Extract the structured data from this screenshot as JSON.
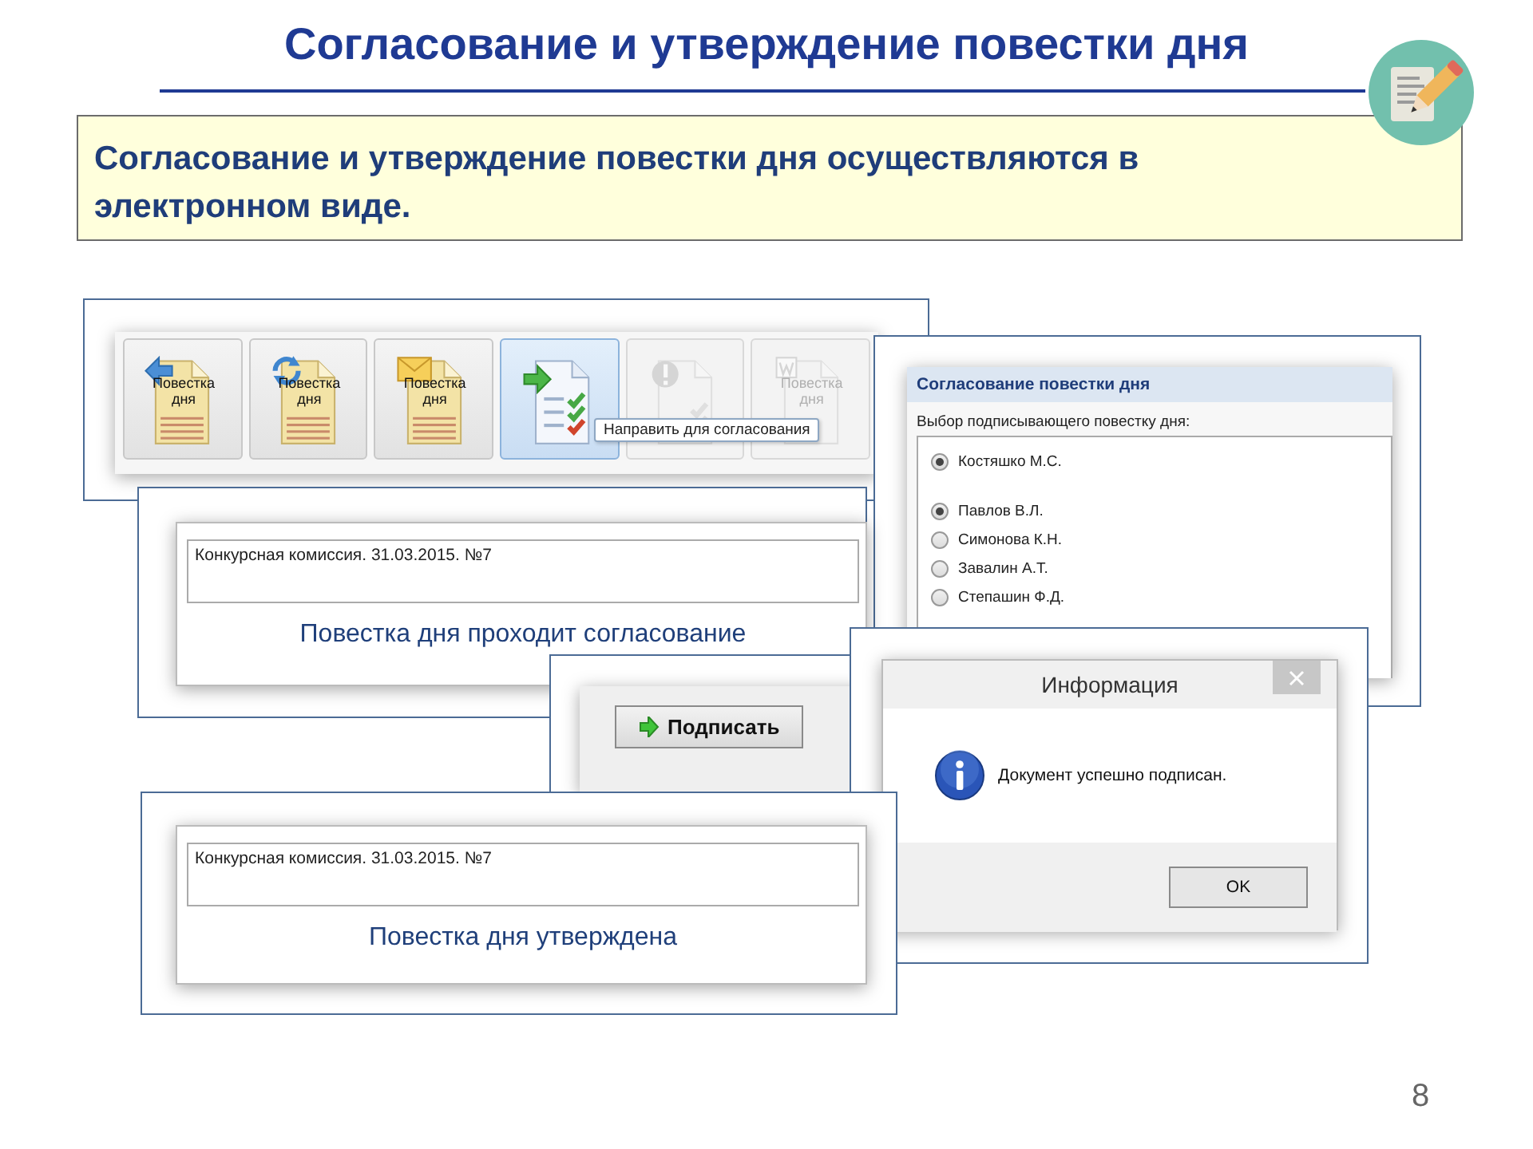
{
  "slide": {
    "title": "Согласование и утверждение повестки дня",
    "page_number": "8"
  },
  "callout": {
    "text": "Согласование и утверждение повестки дня осуществляются в электронном виде."
  },
  "toolbar": {
    "buttons": [
      {
        "kind": "back",
        "label": "Повестка дня",
        "selected": false,
        "disabled": false
      },
      {
        "kind": "refresh",
        "label": "Повестка дня",
        "selected": false,
        "disabled": false
      },
      {
        "kind": "mail",
        "label": "Повестка дня",
        "selected": false,
        "disabled": false
      },
      {
        "kind": "send",
        "selected": true,
        "disabled": false
      },
      {
        "kind": "warning",
        "selected": false,
        "disabled": true
      },
      {
        "kind": "word",
        "label": "Повестка дня",
        "selected": false,
        "disabled": true
      }
    ],
    "tooltip": "Направить для согласования"
  },
  "approval_dialog": {
    "title": "Согласование повестки дня",
    "prompt": "Выбор подписывающего повестку дня:",
    "options": [
      {
        "label": "Костяшко М.С.",
        "selected": true,
        "gap_after": true
      },
      {
        "label": "Павлов В.Л.",
        "selected": true
      },
      {
        "label": "Симонова К.Н.",
        "selected": false
      },
      {
        "label": "Завалин А.Т.",
        "selected": false
      },
      {
        "label": "Степашин Ф.Д.",
        "selected": false
      }
    ]
  },
  "agenda_cards": [
    {
      "document": "Конкурсная комиссия. 31.03.2015. №7",
      "status": "Повестка дня проходит согласование"
    },
    {
      "document": "Конкурсная комиссия. 31.03.2015. №7",
      "status": "Повестка дня утверждена"
    }
  ],
  "sign_panel": {
    "button": "Подписать"
  },
  "info_dialog": {
    "title": "Информация",
    "message": "Документ успешно подписан.",
    "button": "OK"
  }
}
